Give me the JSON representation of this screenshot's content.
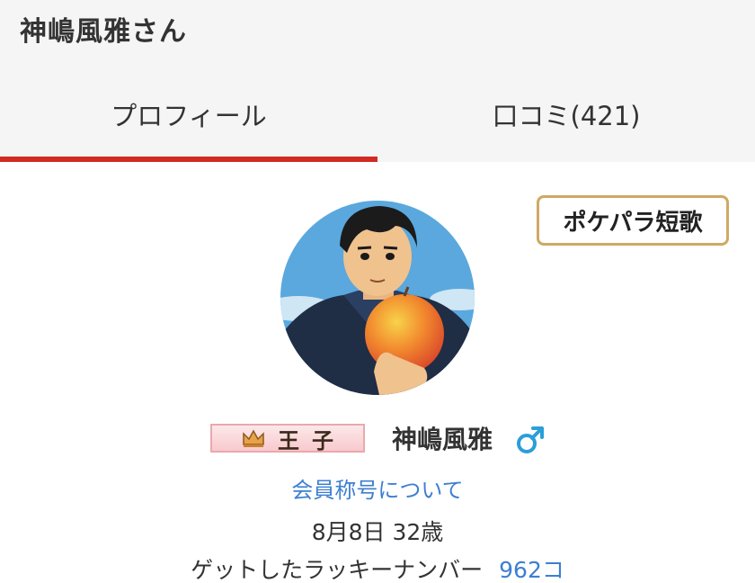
{
  "header": {
    "title": "神嶋風雅さん"
  },
  "tabs": [
    {
      "label": "プロフィール",
      "active": true
    },
    {
      "label": "口コミ(421)",
      "active": false
    }
  ],
  "tanka_button": {
    "label": "ポケパラ短歌"
  },
  "profile": {
    "rank_badge": "王子",
    "name": "神嶋風雅",
    "gender_icon": "male-symbol-icon",
    "about_title_link": "会員称号について",
    "birthday_age": "8月8日 32歳",
    "lucky_number_label": "ゲットしたラッキーナンバー",
    "lucky_number_count": "962コ"
  },
  "colors": {
    "active_tab_underline": "#d32a24",
    "link_blue": "#3d7fd1",
    "tanka_border": "#cfa964",
    "header_bg": "#f5f5f5",
    "male_icon": "#2a9fd8"
  }
}
